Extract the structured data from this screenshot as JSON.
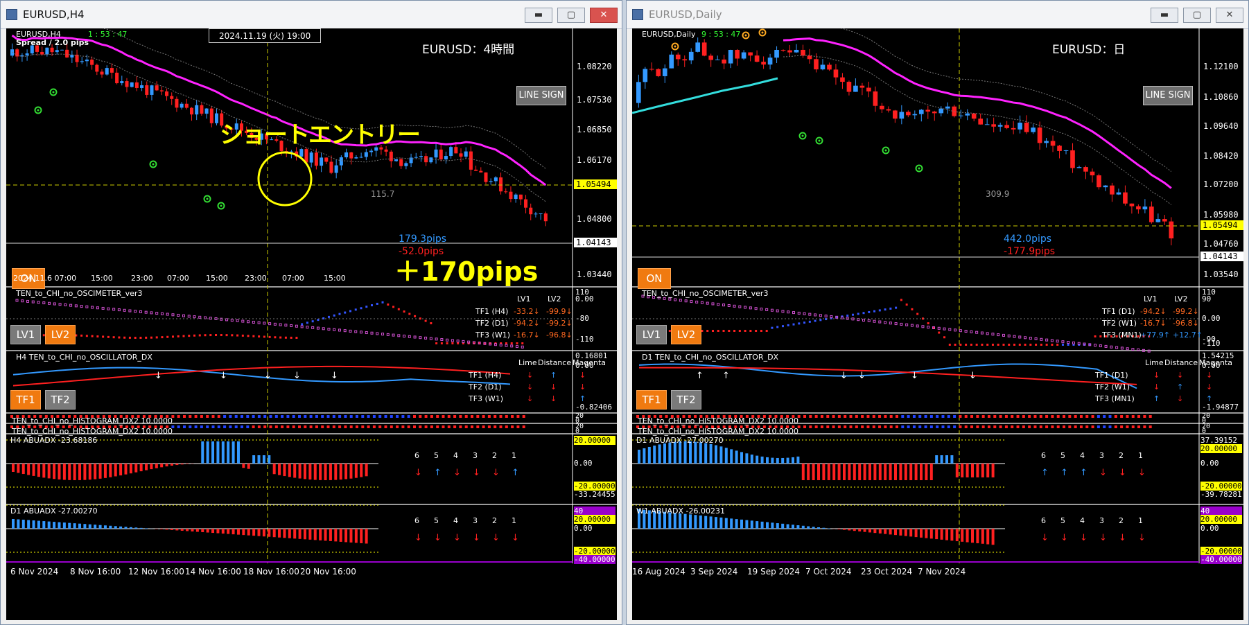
{
  "left": {
    "window_title": "EURUSD,H4",
    "symbol_tf": "EURUSD,H4",
    "timer": "1 : 53 : 47",
    "spread": "Spread / 2.0 pips",
    "crosshair_time": "2024.11.19 (火) 19:00",
    "pair_label": "EURUSD：4時間",
    "line_sign": "LINE SIGN",
    "annotation_entry": "ショートエントリー",
    "annotation_result": "＋170pips",
    "band_value": "115.7",
    "pips_up": "179.3pips",
    "pips_down": "-52.0pips",
    "on_button": "ON",
    "price_ticks": [
      "1.08220",
      "1.07530",
      "1.06850",
      "1.06170",
      "1.04800",
      "1.03440"
    ],
    "crosshair_price": "1.05494",
    "current_price": "1.04143",
    "time_ticks": [
      "2024.11.6 07:00",
      "15:00",
      "23:00",
      "07:00",
      "15:00",
      "23:00",
      "07:00",
      "15:00"
    ],
    "osc_title": "TEN_to_CHI_no_OSCIMETER_ver3",
    "osc_axis": [
      "110",
      "0.00",
      "-80",
      "-110"
    ],
    "lv_headers": [
      "LV1",
      "LV2"
    ],
    "lv_rows": [
      {
        "tf": "TF1 (H4)",
        "v1": "-33.2↓",
        "v2": "-99.9↓",
        "c1": "orange",
        "c2": "orange"
      },
      {
        "tf": "TF2 (D1)",
        "v1": "-94.2↓",
        "v2": "-99.2↓",
        "c1": "orange",
        "c2": "orange"
      },
      {
        "tf": "TF3 (W1)",
        "v1": "-16.7↓",
        "v2": "-96.8↓",
        "c1": "orange",
        "c2": "orange"
      }
    ],
    "lv1_btn": "LV1",
    "lv2_btn": "LV2",
    "dx_title": "H4 TEN_to_CHI_no_OSCILLATOR_DX",
    "dx_axis": [
      "0.16801",
      "0.00",
      "-0.82406"
    ],
    "dx_headers": [
      "Lime",
      "Distance",
      "Magenta"
    ],
    "dx_rows": [
      {
        "tf": "TF1 (H4)",
        "a": "↓",
        "b": "↑",
        "c": "↓",
        "ca": "red",
        "cb": "blue",
        "cc": "red"
      },
      {
        "tf": "TF2 (D1)",
        "a": "↓",
        "b": "↓",
        "c": "↓",
        "ca": "red",
        "cb": "red",
        "cc": "red"
      },
      {
        "tf": "TF3 (W1)",
        "a": "↓",
        "b": "↓",
        "c": "↑",
        "ca": "red",
        "cb": "red",
        "cc": "blue"
      }
    ],
    "tf1_btn": "TF1",
    "tf2_btn": "TF2",
    "hist1_title": "TEN_to_CHI_no_HISTOGRAM_DX2 10.0000",
    "hist2_title": "TEN_to_CHI_no_HISTOGRAM_DX2 10.0000",
    "hist_axis": [
      "20",
      "0"
    ],
    "abu1_title": "H4 ABUADX  -23.68186",
    "abu1_axis": [
      "20.00000",
      "0.00",
      "-20.00000",
      "-33.24455"
    ],
    "abu1_nums": [
      "6",
      "5",
      "4",
      "3",
      "2",
      "1"
    ],
    "abu1_arrows": [
      {
        "a": "↓",
        "c": "red"
      },
      {
        "a": "↑",
        "c": "blue"
      },
      {
        "a": "↓",
        "c": "red"
      },
      {
        "a": "↓",
        "c": "red"
      },
      {
        "a": "↓",
        "c": "red"
      },
      {
        "a": "↑",
        "c": "blue"
      }
    ],
    "abu2_title": "D1 ABUADX  -27.00270",
    "abu2_axis": [
      "40",
      "20.00000",
      "0.00",
      "-20.00000",
      "-40.00000"
    ],
    "abu2_nums": [
      "6",
      "5",
      "4",
      "3",
      "2",
      "1"
    ],
    "abu2_arrows": [
      {
        "a": "↓",
        "c": "red"
      },
      {
        "a": "↓",
        "c": "red"
      },
      {
        "a": "↓",
        "c": "red"
      },
      {
        "a": "↓",
        "c": "red"
      },
      {
        "a": "↓",
        "c": "red"
      },
      {
        "a": "↓",
        "c": "red"
      }
    ],
    "date_ticks": [
      "6 Nov 2024",
      "8 Nov 16:00",
      "12 Nov 16:00",
      "14 Nov 16:00",
      "18 Nov 16:00",
      "20 Nov 16:00"
    ]
  },
  "right": {
    "window_title": "EURUSD,Daily",
    "symbol_tf": "EURUSD,Daily",
    "timer": "9 : 53 : 47",
    "pair_label": "EURUSD：日",
    "line_sign": "LINE SIGN",
    "band_value": "309.9",
    "pips_up": "442.0pips",
    "pips_down": "-177.9pips",
    "on_button": "ON",
    "price_ticks": [
      "1.12100",
      "1.10860",
      "1.09640",
      "1.08420",
      "1.07200",
      "1.05980",
      "1.04760",
      "1.03540"
    ],
    "crosshair_price": "1.05494",
    "current_price": "1.04143",
    "osc_title": "TEN_to_CHI_no_OSCIMETER_ver3",
    "osc_axis": [
      "110",
      "90",
      "0.00",
      "-90",
      "-110"
    ],
    "lv_headers": [
      "LV1",
      "LV2"
    ],
    "lv_rows": [
      {
        "tf": "TF1 (D1)",
        "v1": "-94.2↓",
        "v2": "-99.2↓",
        "c1": "orange",
        "c2": "orange"
      },
      {
        "tf": "TF2 (W1)",
        "v1": "-16.7↓",
        "v2": "-96.8↓",
        "c1": "orange",
        "c2": "orange"
      },
      {
        "tf": "TF3 (MN1)",
        "v1": "+77.9↑",
        "v2": "+12.7↑",
        "c1": "blue",
        "c2": "blue"
      }
    ],
    "lv1_btn": "LV1",
    "lv2_btn": "LV2",
    "dx_title": "D1 TEN_to_CHI_no_OSCILLATOR_DX",
    "dx_axis": [
      "1.54215",
      "0.00",
      "-1.94877"
    ],
    "dx_headers": [
      "Lime",
      "Distance",
      "Magenta"
    ],
    "dx_rows": [
      {
        "tf": "TF1 (D1)",
        "a": "↓",
        "b": "↓",
        "c": "↓",
        "ca": "red",
        "cb": "red",
        "cc": "red"
      },
      {
        "tf": "TF2 (W1)",
        "a": "↓",
        "b": "↑",
        "c": "↓",
        "ca": "red",
        "cb": "blue",
        "cc": "red"
      },
      {
        "tf": "TF3 (MN1)",
        "a": "↑",
        "b": "↓",
        "c": "↑",
        "ca": "blue",
        "cb": "red",
        "cc": "blue"
      }
    ],
    "tf1_btn": "TF1",
    "tf2_btn": "TF2",
    "hist1_title": "TEN_to_CHI_no_HISTOGRAM_DX2 10.0000",
    "hist2_title": "TEN_to_CHI_no_HISTOGRAM_DX2 10.0000",
    "hist_axis": [
      "20",
      "0"
    ],
    "abu1_title": "D1 ABUADX  -27.00270",
    "abu1_axis": [
      "37.39152",
      "20.00000",
      "0.00",
      "-20.00000",
      "-39.78281"
    ],
    "abu1_nums": [
      "6",
      "5",
      "4",
      "3",
      "2",
      "1"
    ],
    "abu1_arrows": [
      {
        "a": "↑",
        "c": "blue"
      },
      {
        "a": "↑",
        "c": "blue"
      },
      {
        "a": "↑",
        "c": "blue"
      },
      {
        "a": "↓",
        "c": "red"
      },
      {
        "a": "↓",
        "c": "red"
      },
      {
        "a": "↓",
        "c": "red"
      }
    ],
    "abu2_title": "W1 ABUADX  -26.00231",
    "abu2_axis": [
      "40",
      "20.00000",
      "0.00",
      "-20.00000",
      "-40.00000"
    ],
    "abu2_nums": [
      "6",
      "5",
      "4",
      "3",
      "2",
      "1"
    ],
    "abu2_arrows": [
      {
        "a": "↓",
        "c": "red"
      },
      {
        "a": "↓",
        "c": "red"
      },
      {
        "a": "↓",
        "c": "red"
      },
      {
        "a": "↓",
        "c": "red"
      },
      {
        "a": "↓",
        "c": "red"
      },
      {
        "a": "↓",
        "c": "red"
      }
    ],
    "date_ticks": [
      "16 Aug 2024",
      "3 Sep 2024",
      "19 Sep 2024",
      "7 Oct 2024",
      "23 Oct 2024",
      "7 Nov 2024"
    ]
  },
  "colors": {
    "bull": "#3399ff",
    "bear": "#ff2020",
    "magenta_ma": "#ff22ff",
    "cyan_ma": "#33dddd",
    "crosshair": "#cccc00",
    "accent_orange": "#f07a10",
    "annotation_yellow": "#ffff00"
  }
}
